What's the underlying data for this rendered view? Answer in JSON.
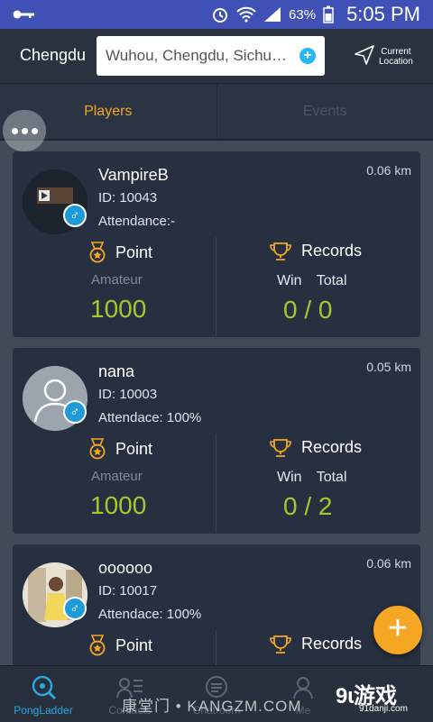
{
  "status_bar": {
    "battery": "63%",
    "time": "5:05 PM"
  },
  "location_bar": {
    "city": "Chengdu",
    "search_value": "Wuhou, Chengdu, Sichu…",
    "current_location_label_1": "Current",
    "current_location_label_2": "Location"
  },
  "tabs": [
    {
      "label": "Players"
    },
    {
      "label": "Events"
    }
  ],
  "labels": {
    "point": "Point",
    "records": "Records",
    "win_total": "Win  Total"
  },
  "players": [
    {
      "name": "VampireB",
      "id": "ID: 10043",
      "attendance": "Attendance:-",
      "distance": "0.06 km",
      "level": "Amateur",
      "points": "1000",
      "record": "0 / 0"
    },
    {
      "name": "nana",
      "id": "ID: 10003",
      "attendance": "Attendace: 100%",
      "distance": "0.05 km",
      "level": "Amateur",
      "points": "1000",
      "record": "0 / 2"
    },
    {
      "name": "oooooo",
      "id": "ID: 10017",
      "attendance": "Attendace: 100%",
      "distance": "0.06 km",
      "level": "",
      "points": "",
      "record": ""
    }
  ],
  "bottom_nav": [
    {
      "label": "PongLadder",
      "icon": "ladder-search-icon"
    },
    {
      "label": "Contacts",
      "icon": "contacts-icon"
    },
    {
      "label": "Chatroom",
      "icon": "chat-icon"
    },
    {
      "label": "Me",
      "icon": "profile-icon"
    }
  ],
  "watermark": {
    "left": "康堂门 • KANGZM.COM",
    "logo": "9ɩ游戏",
    "url": "91danji.com"
  },
  "colors": {
    "accent": "#f5a623",
    "highlight": "#a5c92b",
    "nav_active": "#29a9e1",
    "status_bar": "#3f51b5"
  }
}
